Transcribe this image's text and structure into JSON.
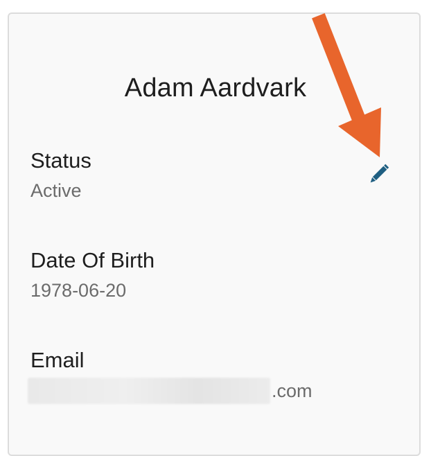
{
  "profile": {
    "name": "Adam Aardvark",
    "fields": {
      "status": {
        "label": "Status",
        "value": "Active"
      },
      "date_of_birth": {
        "label": "Date Of Birth",
        "value": "1978-06-20"
      },
      "email": {
        "label": "Email",
        "value_suffix": ".com"
      }
    }
  },
  "icons": {
    "edit": "pencil-icon",
    "annotation": "arrow-pointer"
  },
  "colors": {
    "card_background": "#f9f9f9",
    "card_border": "#dcdcdc",
    "edit_icon": "#1f5f82",
    "annotation_arrow": "#e8652c",
    "label_text": "#1e1e1e",
    "value_text": "#6b6b6b"
  }
}
